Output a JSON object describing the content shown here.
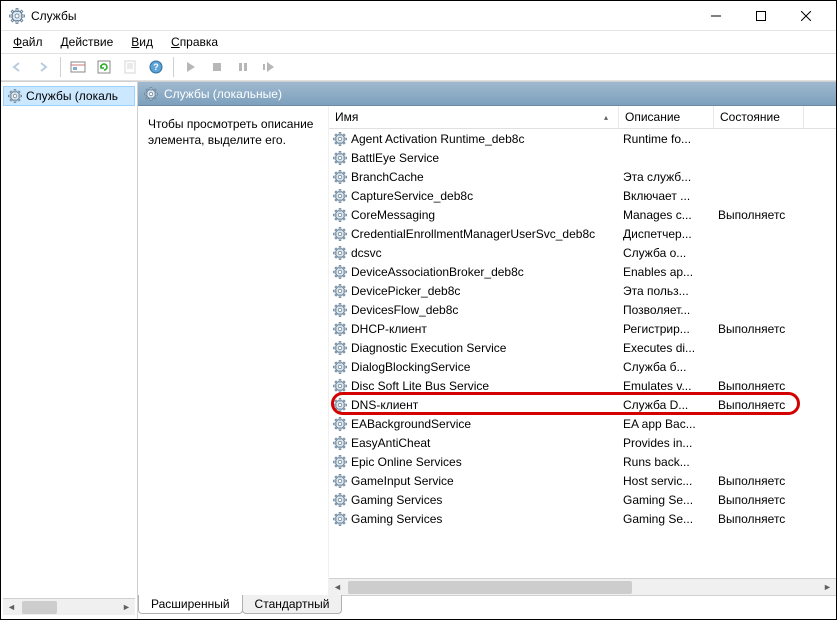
{
  "window": {
    "title": "Службы"
  },
  "menu": {
    "file": "Файл",
    "action": "Действие",
    "view": "Вид",
    "help": "Справка"
  },
  "tree": {
    "root": "Службы (локаль"
  },
  "panel": {
    "header": "Службы (локальные)",
    "hint": "Чтобы просмотреть описание элемента, выделите его."
  },
  "columns": {
    "name": "Имя",
    "description": "Описание",
    "status": "Состояние"
  },
  "col_widths": {
    "name": 290,
    "description": 95,
    "status": 90
  },
  "tabs": {
    "extended": "Расширенный",
    "standard": "Стандартный"
  },
  "highlight_index": 15,
  "services": [
    {
      "name": "Agent Activation Runtime_deb8c",
      "desc": "Runtime fo...",
      "status": ""
    },
    {
      "name": "BattlEye Service",
      "desc": "",
      "status": ""
    },
    {
      "name": "BranchCache",
      "desc": "Эта служб...",
      "status": ""
    },
    {
      "name": "CaptureService_deb8c",
      "desc": "Включает ...",
      "status": ""
    },
    {
      "name": "CoreMessaging",
      "desc": "Manages c...",
      "status": "Выполняетс"
    },
    {
      "name": "CredentialEnrollmentManagerUserSvc_deb8c",
      "desc": "Диспетчер...",
      "status": ""
    },
    {
      "name": "dcsvc",
      "desc": "Служба о...",
      "status": ""
    },
    {
      "name": "DeviceAssociationBroker_deb8c",
      "desc": "Enables ap...",
      "status": ""
    },
    {
      "name": "DevicePicker_deb8c",
      "desc": "Эта польз...",
      "status": ""
    },
    {
      "name": "DevicesFlow_deb8c",
      "desc": "Позволяет...",
      "status": ""
    },
    {
      "name": "DHCP-клиент",
      "desc": "Регистрир...",
      "status": "Выполняетс"
    },
    {
      "name": "Diagnostic Execution Service",
      "desc": "Executes di...",
      "status": ""
    },
    {
      "name": "DialogBlockingService",
      "desc": "Служба б...",
      "status": ""
    },
    {
      "name": "Disc Soft Lite Bus Service",
      "desc": "Emulates v...",
      "status": "Выполняетс"
    },
    {
      "name": "DNS-клиент",
      "desc": "Служба D...",
      "status": "Выполняетс"
    },
    {
      "name": "EABackgroundService",
      "desc": "EA app Bac...",
      "status": ""
    },
    {
      "name": "EasyAntiCheat",
      "desc": "Provides in...",
      "status": ""
    },
    {
      "name": "Epic Online Services",
      "desc": "Runs back...",
      "status": ""
    },
    {
      "name": "GameInput Service",
      "desc": "Host servic...",
      "status": "Выполняетс"
    },
    {
      "name": "Gaming Services",
      "desc": "Gaming Se...",
      "status": "Выполняетс"
    },
    {
      "name": "Gaming Services",
      "desc": "Gaming Se...",
      "status": "Выполняетс"
    }
  ]
}
